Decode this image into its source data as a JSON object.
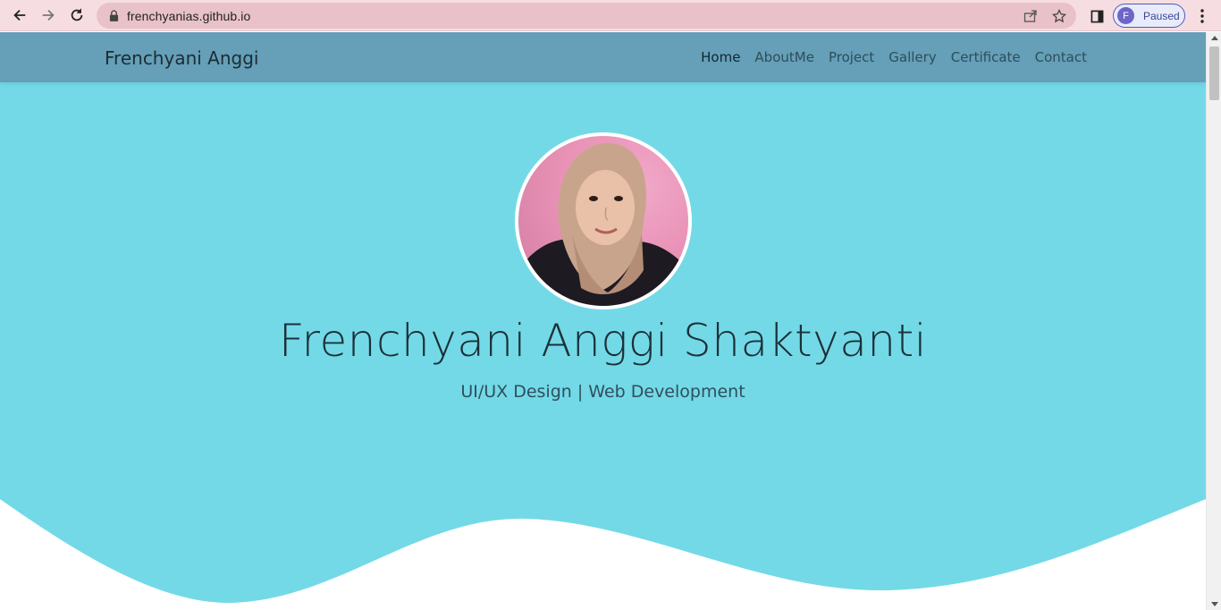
{
  "browser": {
    "url": "frenchyanias.github.io",
    "profile_initial": "F",
    "profile_status": "Paused",
    "icons": [
      "back-icon",
      "forward-icon",
      "reload-icon",
      "lock-icon",
      "share-icon",
      "star-icon",
      "side-panel-icon",
      "menu-kebab-icon"
    ]
  },
  "navbar": {
    "brand": "Frenchyani Anggi",
    "items": [
      {
        "label": "Home",
        "active": true
      },
      {
        "label": "AboutMe",
        "active": false
      },
      {
        "label": "Project",
        "active": false
      },
      {
        "label": "Gallery",
        "active": false
      },
      {
        "label": "Certificate",
        "active": false
      },
      {
        "label": "Contact",
        "active": false
      }
    ]
  },
  "hero": {
    "name": "Frenchyani Anggi Shaktyanti",
    "subtitle": "UI/UX Design | Web Development"
  },
  "colors": {
    "hero_bg": "#73d9e7",
    "navbar_bg": "#659fb8",
    "chrome_bg": "#f6dde1",
    "omnibox_bg": "#e8c2c8"
  }
}
